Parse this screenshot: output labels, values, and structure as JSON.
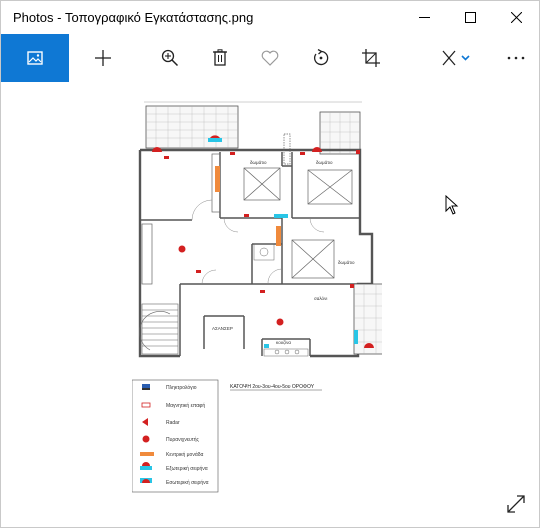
{
  "window": {
    "title": "Photos - Τοπογραφικό Εγκατάστασης.png"
  },
  "toolbar": {
    "items": [
      {
        "name": "image-view",
        "icon": "image-icon"
      },
      {
        "name": "add",
        "icon": "plus-icon"
      },
      {
        "name": "zoom",
        "icon": "zoom-in-icon"
      },
      {
        "name": "delete",
        "icon": "trash-icon"
      },
      {
        "name": "favorite",
        "icon": "heart-icon"
      },
      {
        "name": "rotate",
        "icon": "rotate-icon"
      },
      {
        "name": "crop",
        "icon": "crop-icon"
      },
      {
        "name": "edit",
        "icon": "edit-icon"
      },
      {
        "name": "more",
        "icon": "more-icon"
      }
    ]
  },
  "plan": {
    "caption": "ΚΑΤΟΨΗ 2ου-3ου-4ου-5ου ΟΡΟΦΟΥ",
    "rooms": {
      "bedroom1": "δωμάτιο",
      "bedroom2": "δωμάτιο",
      "bedroom3": "δωμάτιο",
      "living": "σαλόνι",
      "kitchen": "κουζίνα",
      "elevator": "ΑΣΑΝΣΕΡ"
    },
    "legend": [
      {
        "label": "Πληκτρολόγιο"
      },
      {
        "label": "Μαγνητική επαφή"
      },
      {
        "label": "Radar"
      },
      {
        "label": "Πυρανιχνευτής"
      },
      {
        "label": "Κεντρική μονάδα"
      },
      {
        "label": "Εξωτερική σειρήνα"
      },
      {
        "label": "Εσωτερική σειρήνα"
      }
    ]
  },
  "colors": {
    "accent": "#0f78d4",
    "wall": "#555555",
    "alarm_red": "#d32020",
    "siren_cyan": "#29c5e6",
    "panel_orange": "#f08a3c"
  }
}
